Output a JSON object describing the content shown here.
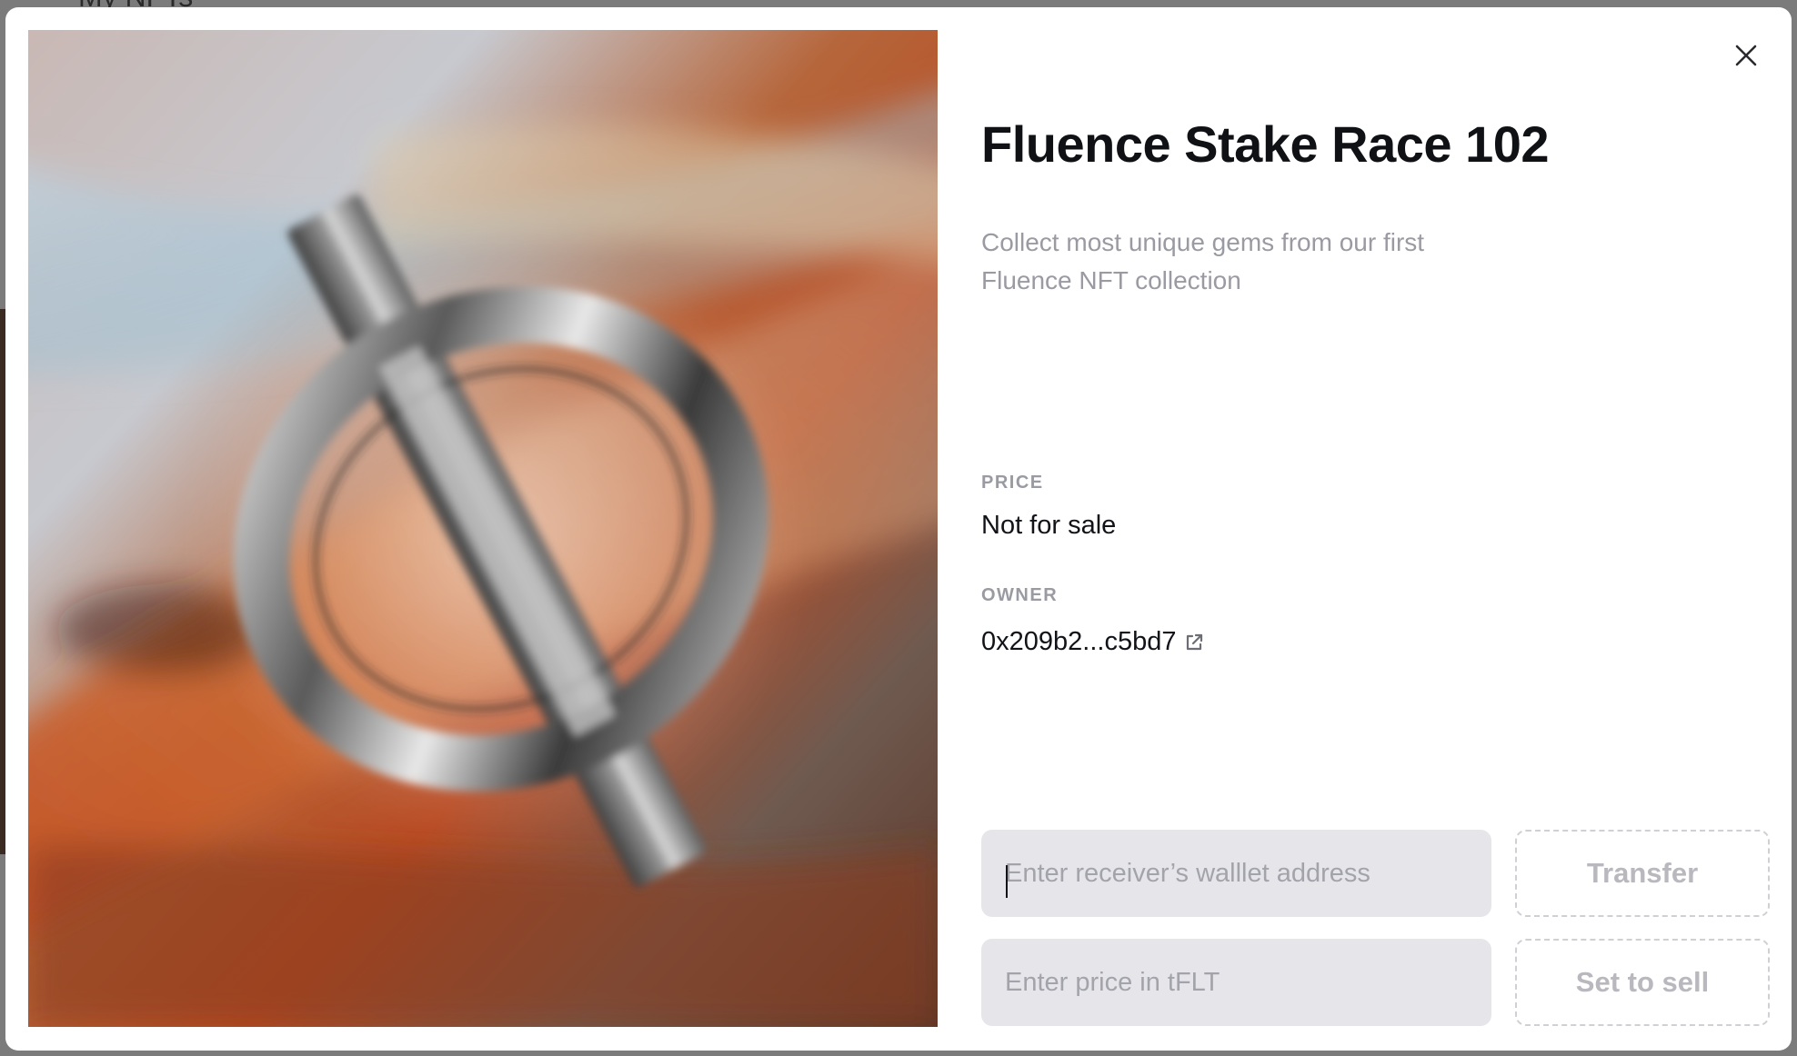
{
  "background": {
    "page_title": "My NFTs"
  },
  "modal": {
    "artwork_alt": "Fluence Stake Race 102 artwork",
    "close_icon": "close-icon",
    "title": "Fluence Stake Race 102",
    "description": "Collect most unique gems from our first Fluence NFT collection",
    "price": {
      "label": "PRICE",
      "value": "Not for sale"
    },
    "owner": {
      "label": "OWNER",
      "address": "0x209b2...c5bd7",
      "link_icon": "external-link-icon"
    },
    "transfer": {
      "placeholder": "Enter receiver’s walllet address",
      "value": "",
      "button_label": "Transfer"
    },
    "sell": {
      "placeholder": "Enter price in tFLT",
      "value": "",
      "button_label": "Set to sell"
    }
  },
  "colors": {
    "title": "#0f1115",
    "muted": "#9a9aa2",
    "field_bg": "#e6e6ea",
    "dashed_border": "#cfcfd4"
  }
}
